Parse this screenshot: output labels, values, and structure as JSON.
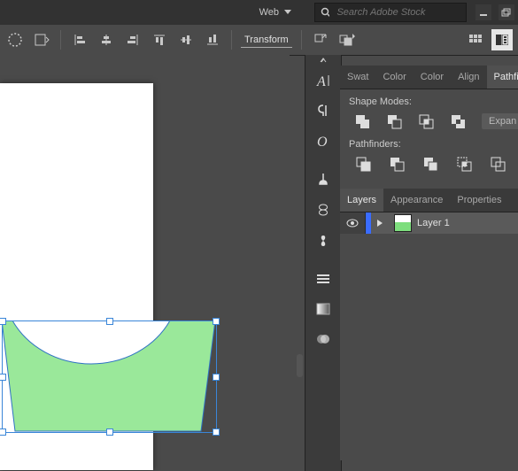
{
  "topbar": {
    "workspace": "Web",
    "search_placeholder": "Search Adobe Stock"
  },
  "controlbar": {
    "transform_label": "Transform"
  },
  "right_tabs_top": [
    "Swat",
    "Color",
    "Color",
    "Align",
    "Pathfinder"
  ],
  "pathfinder": {
    "shape_modes_label": "Shape Modes:",
    "pathfinders_label": "Pathfinders:",
    "expand_label": "Expan"
  },
  "right_tabs_mid": [
    "Layers",
    "Appearance",
    "Properties"
  ],
  "layers": {
    "layer1_name": "Layer 1"
  }
}
